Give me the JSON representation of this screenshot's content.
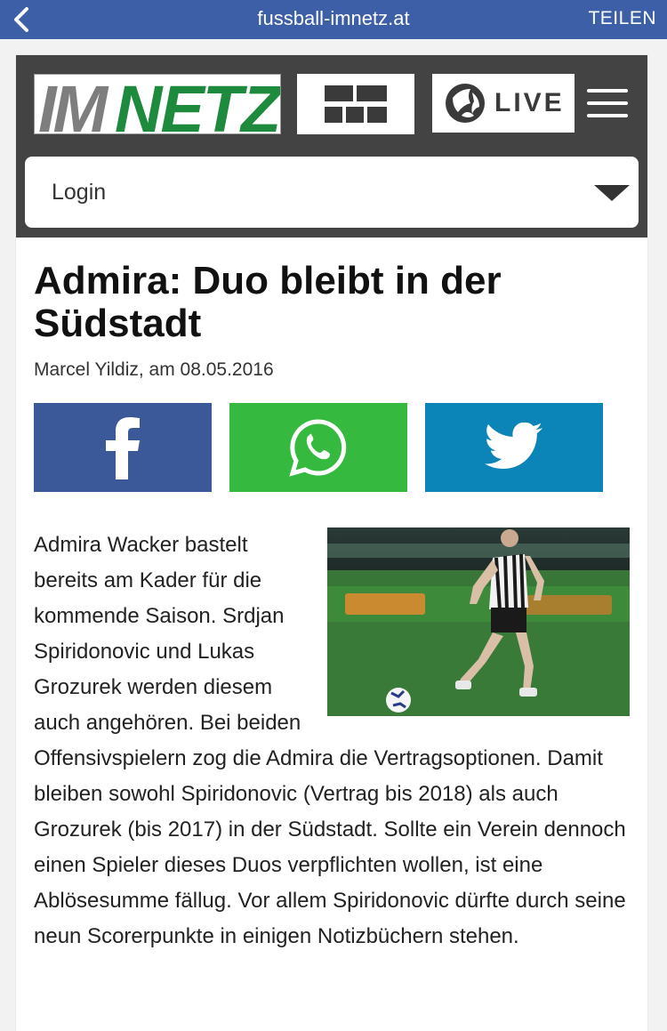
{
  "browser": {
    "url": "fussball-imnetz.at",
    "share_label": "TEILEN",
    "back_icon": "chevron-left-icon",
    "bar_color": "#3d5fa8"
  },
  "site": {
    "logo_part1": "IM",
    "logo_part2": "NETZ",
    "logo_colors": {
      "im": "#7e7e7e",
      "netz": "#1e8a3d"
    },
    "live_label": "LIVE",
    "login_label": "Login",
    "header_color": "#434343"
  },
  "article": {
    "title": "Admira: Duo bleibt in der Südstadt",
    "byline": "Marcel Yildiz, am 08.05.2016",
    "body": "Admira Wacker bastelt bereits am Kader für die kommende Saison. Srdjan Spiridonovic und Lukas Grozurek werden diesem auch angehören. Bei beiden Offensivspielern zog die Admira die Vertragsoptionen. Damit bleiben sowohl Spiridonovic (Vertrag bis 2018) als auch Grozurek (bis 2017) in der Südstadt. Sollte ein Verein dennoch einen Spieler dieses Duos verpflichten wollen, ist eine Ablösesumme fällug. Vor allem Spiridonovic dürfte durch seine neun Scorerpunkte in einigen Notizbüchern stehen."
  },
  "share_buttons": [
    {
      "network": "facebook",
      "icon": "facebook-icon",
      "color": "#3b5998"
    },
    {
      "network": "whatsapp",
      "icon": "whatsapp-icon",
      "color": "#35b93f"
    },
    {
      "network": "twitter",
      "icon": "twitter-icon",
      "color": "#0b84b8"
    }
  ]
}
